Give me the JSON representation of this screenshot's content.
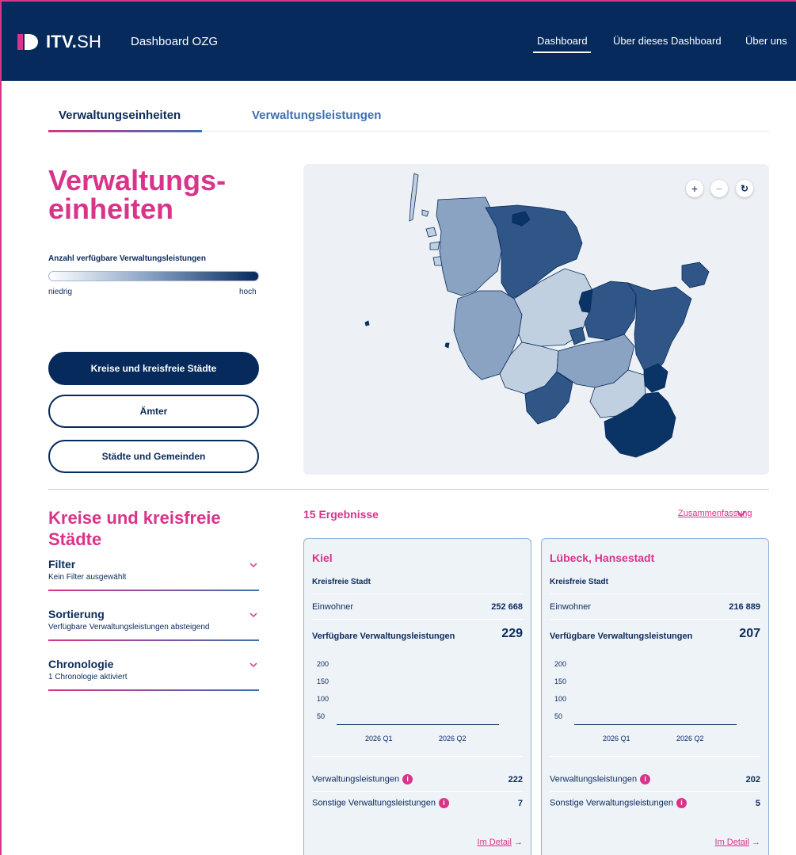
{
  "header": {
    "brand_bold": "ITV.",
    "brand_light": "SH",
    "app_title": "Dashboard OZG",
    "nav": [
      "Dashboard",
      "Über dieses Dashboard",
      "Über uns"
    ]
  },
  "tabs": [
    "Verwaltungseinheiten",
    "Verwaltungsleistungen"
  ],
  "hero": {
    "title_line1": "Verwaltungs-",
    "title_line2": "einheiten",
    "legend_label": "Anzahl verfügbare Verwaltungsleistungen",
    "legend_low": "niedrig",
    "legend_high": "hoch"
  },
  "level_buttons": [
    "Kreise und kreisfreie Städte",
    "Ämter",
    "Städte und Gemeinden"
  ],
  "map": {
    "zoom_in": "+",
    "zoom_out": "−",
    "reset": "↻",
    "colors": {
      "dark": "#0a3466",
      "mid_dark": "#2f5686",
      "mid": "#8aa3c2",
      "light": "#c1d0e0",
      "outline": "#062a5c"
    }
  },
  "list_section": {
    "title": "Kreise und kreisfreie Städte",
    "filters": [
      {
        "title": "Filter",
        "value": "Kein Filter ausgewählt"
      },
      {
        "title": "Sortierung",
        "value": "Verfügbare Verwaltungsleistungen absteigend"
      },
      {
        "title": "Chronologie",
        "value": "1 Chronologie aktiviert"
      }
    ]
  },
  "results": {
    "count_label": "15 Ergebnisse",
    "summary_label": "Zusammenfassung"
  },
  "cards": [
    {
      "name": "Kiel",
      "type": "Kreisfreie Stadt",
      "population_label": "Einwohner",
      "population": "252 668",
      "services_label": "Verfügbare Verwaltungsleistungen",
      "services_total": "229",
      "admin_services_label": "Verwaltungsleistungen",
      "admin_services": "222",
      "other_services_label": "Sonstige Verwaltungsleistungen",
      "other_services": "7",
      "detail_label": "Im Detail"
    },
    {
      "name": "Lübeck, Hansestadt",
      "type": "Kreisfreie Stadt",
      "population_label": "Einwohner",
      "population": "216 889",
      "services_label": "Verfügbare Verwaltungsleistungen",
      "services_total": "207",
      "admin_services_label": "Verwaltungsleistungen",
      "admin_services": "202",
      "other_services_label": "Sonstige Verwaltungsleistungen",
      "other_services": "5",
      "detail_label": "Im Detail"
    }
  ],
  "chart_data": [
    {
      "type": "line",
      "title": "",
      "x": [
        "2026 Q1",
        "2026 Q2"
      ],
      "yticks": [
        "200",
        "150",
        "100",
        "50"
      ],
      "series": []
    },
    {
      "type": "line",
      "title": "",
      "x": [
        "2026 Q1",
        "2026 Q2"
      ],
      "yticks": [
        "200",
        "150",
        "100",
        "50"
      ],
      "series": []
    }
  ]
}
